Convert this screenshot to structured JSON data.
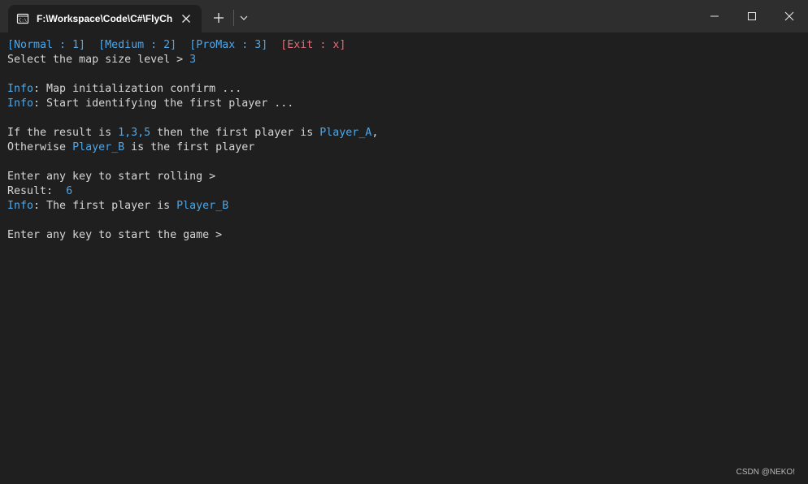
{
  "window": {
    "tab_title": "F:\\Workspace\\Code\\C#\\FlyCh",
    "icons": {
      "tab": "terminal-icon",
      "close_tab": "close-icon",
      "new_tab": "plus-icon",
      "dropdown": "chevron-down-icon",
      "minimize": "minimize-icon",
      "maximize": "maximize-icon",
      "close": "close-icon"
    }
  },
  "colors": {
    "background": "#1f1f1f",
    "titlebar": "#2e2e2e",
    "text": "#d6d6d6",
    "highlight": "#4ea6e6",
    "exit": "#e06c75"
  },
  "terminal": {
    "menu": {
      "normal": "[Normal : 1]",
      "medium": "[Medium : 2]",
      "promax": "[ProMax : 3]",
      "exit": "[Exit : x]"
    },
    "prompt_map_size": "Select the map size level > ",
    "map_size_value": "3",
    "info_label": "Info",
    "info_map_init": ": Map initialization confirm ...",
    "info_identify": ": Start identifying the first player ...",
    "rule_prefix": "If the result is ",
    "rule_values": "1,3,5",
    "rule_middle": " then the first player is ",
    "player_a": "Player_A",
    "rule_comma": ",",
    "otherwise_prefix": "Otherwise ",
    "player_b": "Player_B",
    "otherwise_suffix": " is the first player",
    "prompt_rolling": "Enter any key to start rolling >",
    "result_label": "Result:  ",
    "result_value": "6",
    "info_first_player": ": The first player is ",
    "first_player": "Player_B",
    "prompt_game": "Enter any key to start the game >"
  },
  "watermark": "CSDN @NEKO!"
}
